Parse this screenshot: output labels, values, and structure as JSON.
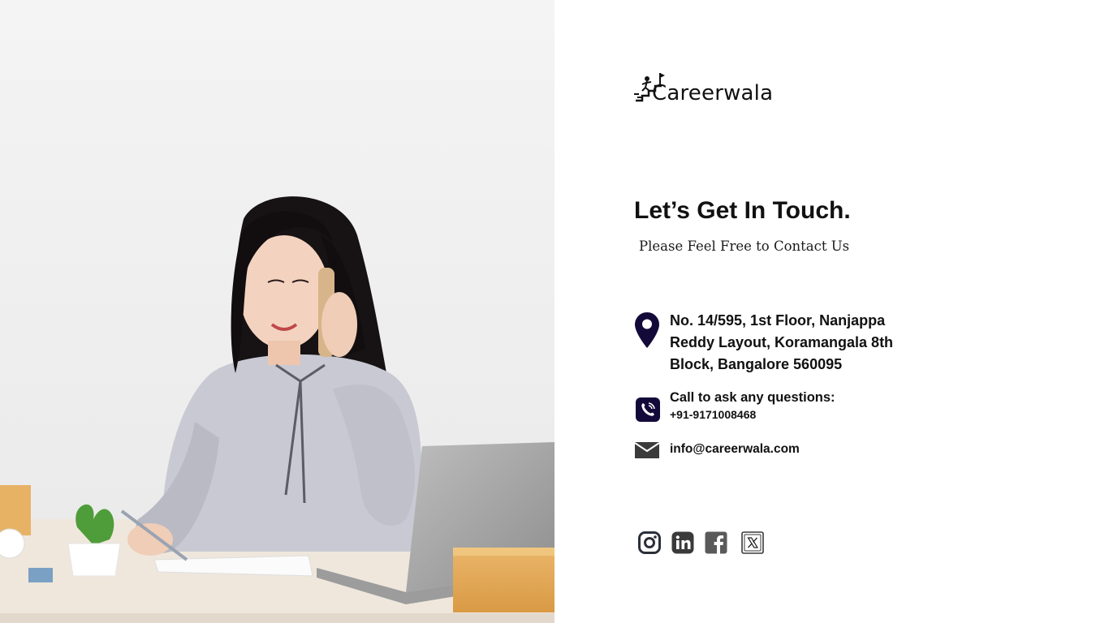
{
  "brand": {
    "logo_text": "Careerwala"
  },
  "contact": {
    "heading": "Let’s Get In Touch.",
    "subheading": "Please Feel Free to Contact Us",
    "address_lines": [
      "No. 14/595, 1st Floor, Nanjappa",
      "Reddy Layout, Koramangala 8th",
      "Block, Bangalore 560095"
    ],
    "phone_label": "Call to ask any questions:",
    "phone_number": "+91-9171008468",
    "email": "info@careerwala.com"
  },
  "socials": [
    {
      "icon": "instagram-icon"
    },
    {
      "icon": "linkedin-icon"
    },
    {
      "icon": "facebook-icon"
    },
    {
      "icon": "x-twitter-icon"
    }
  ],
  "colors": {
    "heading": "#111111",
    "icon_dark": "#140a3a",
    "brand_accent": "#f2b51c",
    "social_grey": "#4a4a4a"
  }
}
